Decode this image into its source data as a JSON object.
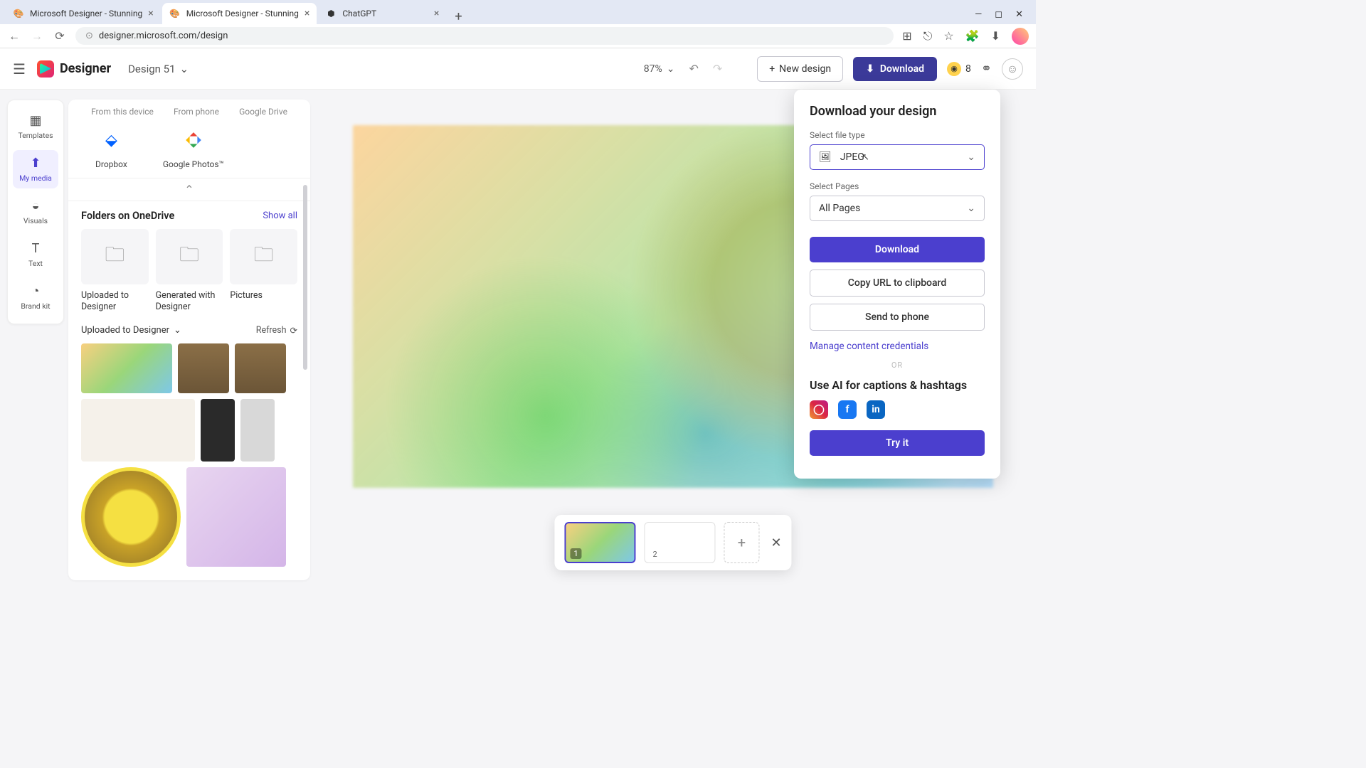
{
  "browser": {
    "tabs": [
      {
        "title": "Microsoft Designer - Stunning"
      },
      {
        "title": "Microsoft Designer - Stunning"
      },
      {
        "title": "ChatGPT"
      }
    ],
    "url": "designer.microsoft.com/design"
  },
  "header": {
    "logo_text": "Designer",
    "design_name": "Design 51",
    "zoom": "87%",
    "new_design_label": "New design",
    "download_label": "Download",
    "coin_count": "8"
  },
  "rail": {
    "templates": "Templates",
    "my_media": "My media",
    "visuals": "Visuals",
    "text": "Text",
    "brand_kit": "Brand kit"
  },
  "media_panel": {
    "upload_tabs": {
      "device": "From this device",
      "phone": "From phone",
      "gdrive": "Google Drive"
    },
    "cloud": {
      "dropbox": "Dropbox",
      "gphotos": "Google Photos™"
    },
    "folders_title": "Folders on OneDrive",
    "show_all": "Show all",
    "folders": {
      "uploaded": "Uploaded to Designer",
      "generated": "Generated with Designer",
      "pictures": "Pictures"
    },
    "uploaded_title": "Uploaded to Designer",
    "refresh": "Refresh"
  },
  "download_panel": {
    "title": "Download your design",
    "file_type_label": "Select file type",
    "file_type_value": "JPEG",
    "pages_label": "Select Pages",
    "pages_value": "All Pages",
    "download_btn": "Download",
    "copy_btn": "Copy URL to clipboard",
    "send_btn": "Send to phone",
    "credentials": "Manage content credentials",
    "or": "OR",
    "ai_title": "Use AI for captions & hashtags",
    "try_btn": "Try it"
  },
  "pages": {
    "p1": "1",
    "p2": "2"
  }
}
